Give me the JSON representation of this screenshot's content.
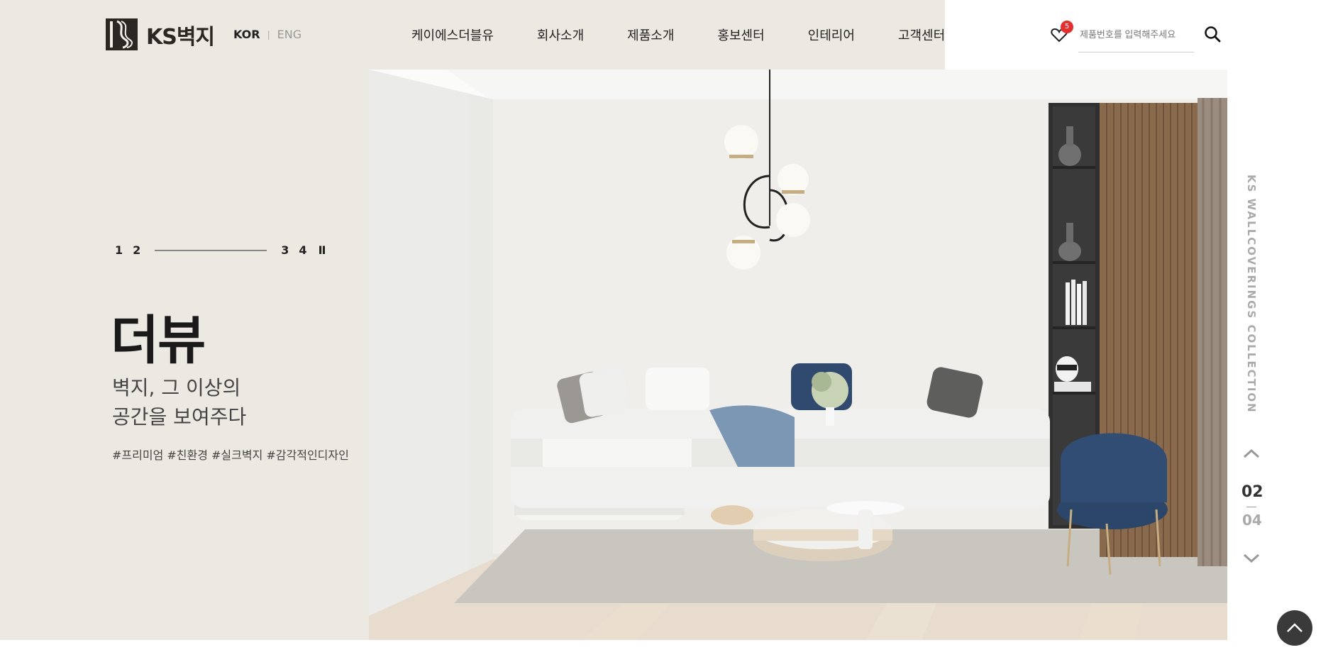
{
  "header": {
    "logo_text": "KS벽지",
    "lang_kor": "KOR",
    "lang_sep": "|",
    "lang_eng": "ENG",
    "nav": [
      "케이에스더블유",
      "회사소개",
      "제품소개",
      "홍보센터",
      "인테리어",
      "고객센터"
    ],
    "wishlist_count": "5",
    "search_placeholder": "제품번호를 입력해주세요"
  },
  "hero": {
    "pager_left": [
      "1",
      "2"
    ],
    "pager_right": [
      "3",
      "4"
    ],
    "pause_label": "II",
    "title": "더뷰",
    "subtitle_line1": "벽지, 그 이상의",
    "subtitle_line2": "공간을 보여주다",
    "tags": "#프리미엄 #친환경 #실크벽지 #감각적인디자인"
  },
  "side": {
    "vertical_label": "KS WALLCOVERINGS COLLECTION",
    "current": "02",
    "total": "04"
  },
  "colors": {
    "beige": "#ece9e3",
    "sofa_blue": "#2f4a6e",
    "wood": "#8a6a4c",
    "badge": "#e2302f"
  }
}
